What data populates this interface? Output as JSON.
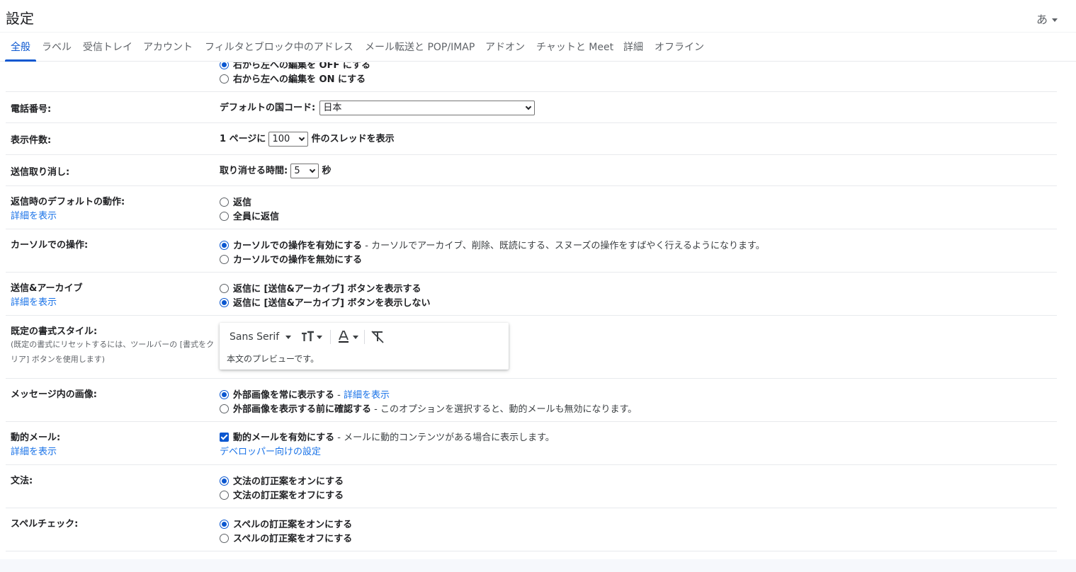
{
  "header": {
    "title": "設定",
    "ime": "あ"
  },
  "tabs": [
    "全般",
    "ラベル",
    "受信トレイ",
    "アカウント",
    "フィルタとブロック中のアドレス",
    "メール転送と POP/IMAP",
    "アドオン",
    "チャットと Meet",
    "詳細",
    "オフライン"
  ],
  "rtl": {
    "opt_off": "右から左への編集を OFF にする",
    "opt_on": "右から左への編集を ON にする"
  },
  "phone": {
    "label": "電話番号:",
    "field_label": "デフォルトの国コード:",
    "value": "日本"
  },
  "page_size": {
    "label": "表示件数:",
    "prefix": "1 ページに",
    "value": "100",
    "suffix": "件のスレッドを表示"
  },
  "undo_send": {
    "label": "送信取り消し:",
    "prefix": "取り消せる時間:",
    "value": "5",
    "suffix": "秒"
  },
  "reply_default": {
    "label": "返信時のデフォルトの動作:",
    "link": "詳細を表示",
    "opt1": "返信",
    "opt2": "全員に返信"
  },
  "hover_actions": {
    "label": "カーソルでの操作:",
    "opt1": "カーソルでの操作を有効にする",
    "opt1_desc": " - カーソルでアーカイブ、削除、既読にする、スヌーズの操作をすばやく行えるようになります。",
    "opt2": "カーソルでの操作を無効にする"
  },
  "send_archive": {
    "label": "送信&アーカイブ",
    "link": "詳細を表示",
    "opt1": "返信に [送信&アーカイブ] ボタンを表示する",
    "opt2": "返信に [送信&アーカイブ] ボタンを表示しない"
  },
  "text_style": {
    "label": "既定の書式スタイル:",
    "note": "(既定の書式にリセットするには、ツールバーの [書式をクリア] ボタンを使用します)",
    "font": "Sans Serif",
    "preview": "本文のプレビューです。"
  },
  "images": {
    "label": "メッセージ内の画像:",
    "opt1": "外部画像を常に表示する",
    "opt1_link": "詳細を表示",
    "opt2": "外部画像を表示する前に確認する",
    "opt2_desc": " - このオプションを選択すると、動的メールも無効になります。"
  },
  "dynamic_email": {
    "label": "動的メール:",
    "link": "詳細を表示",
    "opt1": "動的メールを有効にする",
    "opt1_desc": " - メールに動的コンテンツがある場合に表示します。",
    "dev_link": "デベロッパー向けの設定"
  },
  "grammar": {
    "label": "文法:",
    "opt1": "文法の訂正案をオンにする",
    "opt2": "文法の訂正案をオフにする"
  },
  "spelling": {
    "label": "スペルチェック:",
    "opt1": "スペルの訂正案をオンにする",
    "opt2": "スペルの訂正案をオフにする"
  },
  "colors": {
    "accent": "#0b57d0",
    "link": "#1a73e8",
    "divider": "#e8eaed"
  }
}
